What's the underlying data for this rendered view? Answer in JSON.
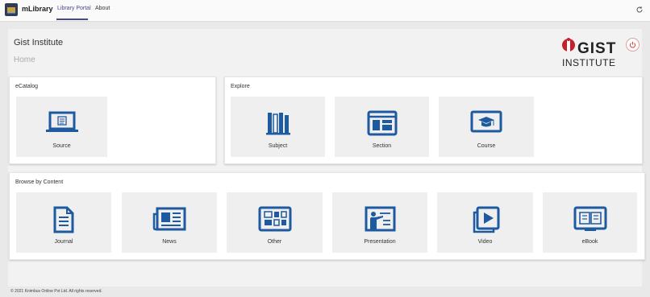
{
  "header": {
    "app_name": "mLibrary",
    "tabs": [
      {
        "label": "Library Portal",
        "active": true
      },
      {
        "label": "About",
        "active": false
      }
    ],
    "refresh_icon": "refresh-icon"
  },
  "institute": {
    "name": "Gist Institute",
    "breadcrumb": "Home",
    "logo_text_top": "GIST",
    "logo_text_bottom": "INSTITUTE"
  },
  "ecatalog": {
    "title": "eCatalog",
    "items": [
      {
        "label": "Source",
        "icon": "laptop-icon"
      }
    ]
  },
  "explore": {
    "title": "Explore",
    "items": [
      {
        "label": "Subject",
        "icon": "books-icon"
      },
      {
        "label": "Section",
        "icon": "browser-window-icon"
      },
      {
        "label": "Course",
        "icon": "graduation-cap-icon"
      }
    ]
  },
  "browse": {
    "title": "Browse by Content",
    "items": [
      {
        "label": "Journal",
        "icon": "document-icon"
      },
      {
        "label": "News",
        "icon": "newspaper-icon"
      },
      {
        "label": "Other",
        "icon": "grid-items-icon"
      },
      {
        "label": "Presentation",
        "icon": "presenter-icon"
      },
      {
        "label": "Video",
        "icon": "video-play-icon"
      },
      {
        "label": "eBook",
        "icon": "ebook-icon"
      }
    ]
  },
  "footer": {
    "text": "© 2021 Knimbus Online Pvt Ltd. All rights reserved."
  },
  "colors": {
    "icon_blue": "#1e5aa0",
    "accent": "#464a8c",
    "logo_red": "#c8202a"
  }
}
